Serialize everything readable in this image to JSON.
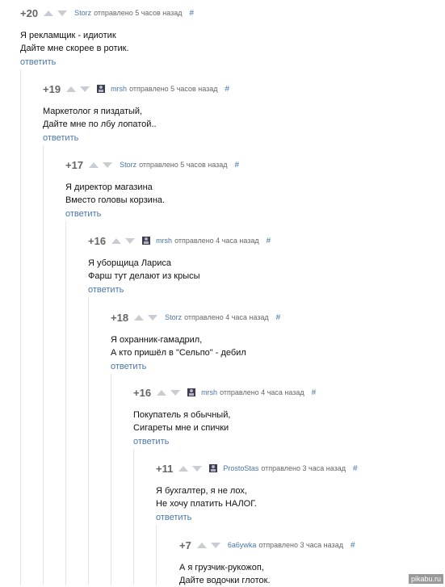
{
  "comments": [
    {
      "rating": "+20",
      "author": "Storz",
      "sent": "отправлено 5 часов назад",
      "anchor": "#",
      "lines": [
        "Я рекламщик - идиотик",
        "Дайте мне скорее в ротик."
      ],
      "reply": "ответить",
      "avatar": false
    },
    {
      "rating": "+19",
      "author": "mrsh",
      "sent": "отправлено 5 часов назад",
      "anchor": "#",
      "lines": [
        "Маркетолог я пиздатый,",
        "Дайте мне по лбу лопатой.."
      ],
      "reply": "ответить",
      "avatar": true
    },
    {
      "rating": "+17",
      "author": "Storz",
      "sent": "отправлено 5 часов назад",
      "anchor": "#",
      "lines": [
        "Я директор магазина",
        "Вместо головы корзина."
      ],
      "reply": "ответить",
      "avatar": false
    },
    {
      "rating": "+16",
      "author": "mrsh",
      "sent": "отправлено 4 часа назад",
      "anchor": "#",
      "lines": [
        "Я уборщица Лариса",
        "Фарш тут делают из крысы"
      ],
      "reply": "ответить",
      "avatar": true
    },
    {
      "rating": "+18",
      "author": "Storz",
      "sent": "отправлено 4 часа назад",
      "anchor": "#",
      "lines": [
        "Я охранник-гамадрил,",
        "А кто пришёл в \"Сельпо\" - дебил"
      ],
      "reply": "ответить",
      "avatar": false
    },
    {
      "rating": "+16",
      "author": "mrsh",
      "sent": "отправлено 4 часа назад",
      "anchor": "#",
      "lines": [
        "Покупатель я обычный,",
        "Сигареты мне и спички"
      ],
      "reply": "ответить",
      "avatar": true
    },
    {
      "rating": "+11",
      "author": "ProstoStas",
      "sent": "отправлено 3 часа назад",
      "anchor": "#",
      "lines": [
        "Я бухгалтер, я не лох,",
        "Не хочу платить НАЛОГ."
      ],
      "reply": "ответить",
      "avatar": true
    },
    {
      "rating": "+7",
      "author": "6a6ywka",
      "sent": "отправлено 3 часа назад",
      "anchor": "#",
      "lines": [
        "А я грузчик-рукожоп,",
        "Дайте водочки глоток."
      ],
      "reply": "",
      "avatar": false
    }
  ],
  "watermark": "pikabu.ru"
}
